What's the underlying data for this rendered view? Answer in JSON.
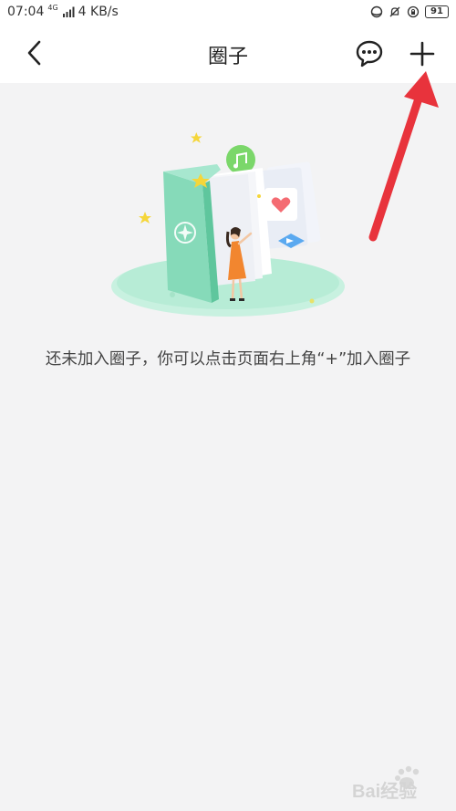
{
  "status_bar": {
    "time": "07:04",
    "network_type": "4G",
    "speed": "4 KB/s",
    "battery_level": "91"
  },
  "nav": {
    "back_icon": "chevron-left-icon",
    "title": "圈子",
    "chat_icon": "chat-bubble-icon",
    "add_icon": "plus-icon"
  },
  "empty_state": {
    "illustration": "book-girl-illustration",
    "message": "还未加入圈子，你可以点击页面右上角“+”加入圈子"
  },
  "annotation": {
    "arrow_color": "#e8333c"
  },
  "colors": {
    "accent_mint": "#9fe3c6",
    "background": "#f3f3f4"
  },
  "watermark": {
    "text": "Bai经验"
  }
}
